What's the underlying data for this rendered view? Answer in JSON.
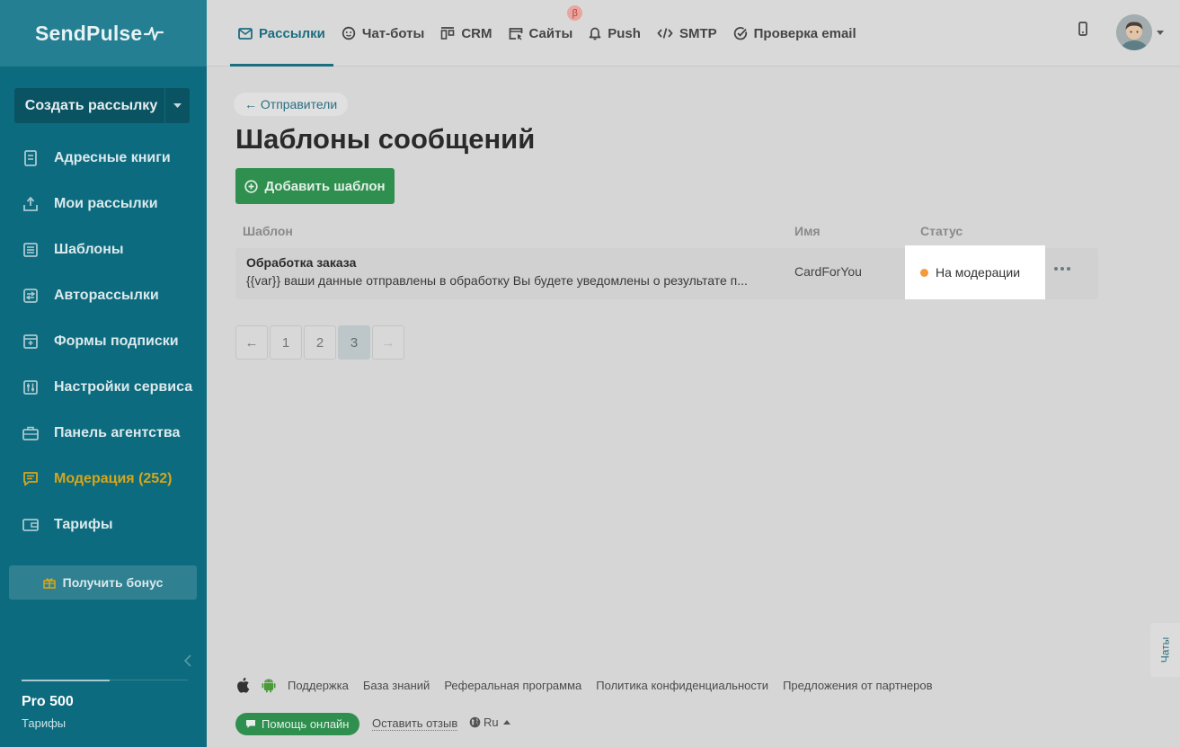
{
  "sidebar": {
    "logo": "SendPulse",
    "create_button": "Создать рассылку",
    "items": [
      {
        "label": "Адресные книги",
        "icon": "address-book-icon"
      },
      {
        "label": "Мои рассылки",
        "icon": "campaigns-icon"
      },
      {
        "label": "Шаблоны",
        "icon": "templates-icon"
      },
      {
        "label": "Авторассылки",
        "icon": "automation-icon"
      },
      {
        "label": "Формы подписки",
        "icon": "forms-icon"
      },
      {
        "label": "Настройки сервиса",
        "icon": "settings-icon"
      },
      {
        "label": "Панель агентства",
        "icon": "agency-icon"
      },
      {
        "label": "Модерация (252)",
        "icon": "moderation-icon",
        "active": true
      },
      {
        "label": "Тарифы",
        "icon": "wallet-icon"
      }
    ],
    "bonus_button": "Получить бонус",
    "plan_name": "Pro 500",
    "plan_link": "Тарифы"
  },
  "topnav": {
    "tabs": [
      {
        "label": "Рассылки",
        "icon": "mail-icon",
        "active": true
      },
      {
        "label": "Чат-боты",
        "icon": "chatbot-icon"
      },
      {
        "label": "CRM",
        "icon": "crm-icon"
      },
      {
        "label": "Сайты",
        "icon": "sites-icon",
        "badge": "β"
      },
      {
        "label": "Push",
        "icon": "bell-icon"
      },
      {
        "label": "SMTP",
        "icon": "code-icon"
      },
      {
        "label": "Проверка email",
        "icon": "check-circle-icon"
      }
    ]
  },
  "main": {
    "back_link": "← Отправители",
    "title": "Шаблоны сообщений",
    "add_button": "Добавить шаблон",
    "columns": {
      "template": "Шаблон",
      "name": "Имя",
      "status": "Статус"
    },
    "rows": [
      {
        "title": "Обработка заказа",
        "description": "{{var}} ваши данные отправлены в обработку Вы будете уведомлены о результате п...",
        "name": "CardForYou",
        "status": "На модерации",
        "status_color": "#f49a3a"
      }
    ],
    "pagination": {
      "prev": "←",
      "pages": [
        "1",
        "2",
        "3"
      ],
      "current": "3",
      "next": "→"
    }
  },
  "footer": {
    "links": [
      "Поддержка",
      "База знаний",
      "Реферальная программа",
      "Политика конфиденциальности",
      "Предложения от партнеров"
    ],
    "help_button": "Помощь онлайн",
    "feedback": "Оставить отзыв",
    "language": "Ru"
  },
  "chats_tab": "Чаты"
}
